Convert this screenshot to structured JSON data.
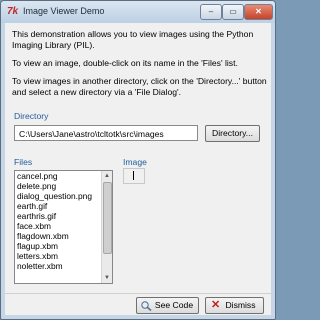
{
  "window": {
    "title": "Image Viewer Demo",
    "controls": [
      "–",
      "▭",
      "✕"
    ]
  },
  "intro": {
    "paragraphs": [
      "This demonstration allows you to view images using the Python Imaging Library (PIL).",
      "To view an image, double-click on its name in the 'Files' list.",
      "To view images in another directory, click on the 'Directory...' button and select a new directory via a 'File Dialog'."
    ]
  },
  "directory": {
    "label": "Directory",
    "path": "C:\\Users\\Jane\\astro\\tcltotk\\src\\images",
    "button_label": "Directory..."
  },
  "files": {
    "label": "Files",
    "items": [
      "cancel.png",
      "delete.png",
      "dialog_question.png",
      "earth.gif",
      "earthris.gif",
      "face.xbm",
      "flagdown.xbm",
      "flagup.xbm",
      "letters.xbm",
      "noletter.xbm"
    ]
  },
  "image": {
    "label": "Image"
  },
  "footer": {
    "see_code_label": "See Code",
    "dismiss_label": "Dismiss"
  }
}
